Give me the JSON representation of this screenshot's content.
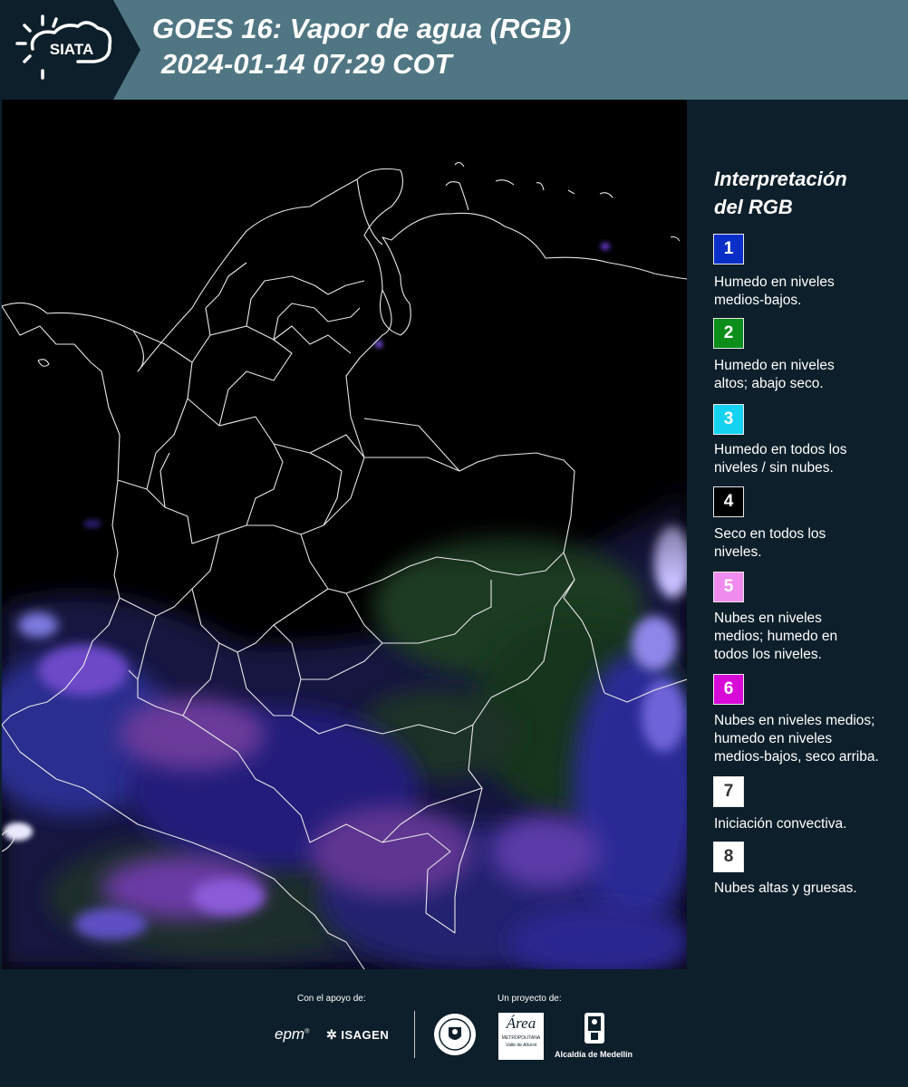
{
  "header": {
    "brand": "SIATA",
    "title_line1": "GOES 16: Vapor de agua (RGB)",
    "title_line2": "2024-01-14 07:29 COT"
  },
  "legend": {
    "title_line1": "Interpretación",
    "title_line2": "del RGB",
    "items": [
      {
        "num": "1",
        "color": "#0a2fc9",
        "lines": [
          "Humedo en niveles",
          "medios-bajos."
        ]
      },
      {
        "num": "2",
        "color": "#0b8f1a",
        "lines": [
          "Humedo en niveles",
          "altos; abajo seco."
        ]
      },
      {
        "num": "3",
        "color": "#15d3f0",
        "lines": [
          "Humedo en todos los",
          "niveles / sin nubes."
        ]
      },
      {
        "num": "4",
        "color": "#000000",
        "lines": [
          "Seco en todos los",
          "niveles."
        ]
      },
      {
        "num": "5",
        "color": "#f08cf0",
        "lines": [
          "Nubes en niveles",
          "medios; humedo en",
          "todos los niveles."
        ]
      },
      {
        "num": "6",
        "color": "#d80ad8",
        "lines": [
          "Nubes en niveles medios;",
          "humedo en niveles",
          "medios-bajos, seco arriba."
        ]
      },
      {
        "num": "7",
        "color": "#ffffff",
        "lines": [
          "Iniciación convectiva."
        ]
      },
      {
        "num": "8",
        "color": "#ffffff",
        "lines": [
          "Nubes altas y gruesas."
        ]
      }
    ]
  },
  "footer": {
    "support_label": "Con el apoyo de:",
    "project_label": "Un proyecto de:",
    "logo_epm": "epm",
    "logo_isagen": "ISAGEN",
    "logo_area_name": "Área",
    "logo_area_sub": "METROPOLITANA",
    "logo_area_tag": "Valle de Aburrá",
    "logo_alcaldia": "Alcaldía de Medellín"
  }
}
